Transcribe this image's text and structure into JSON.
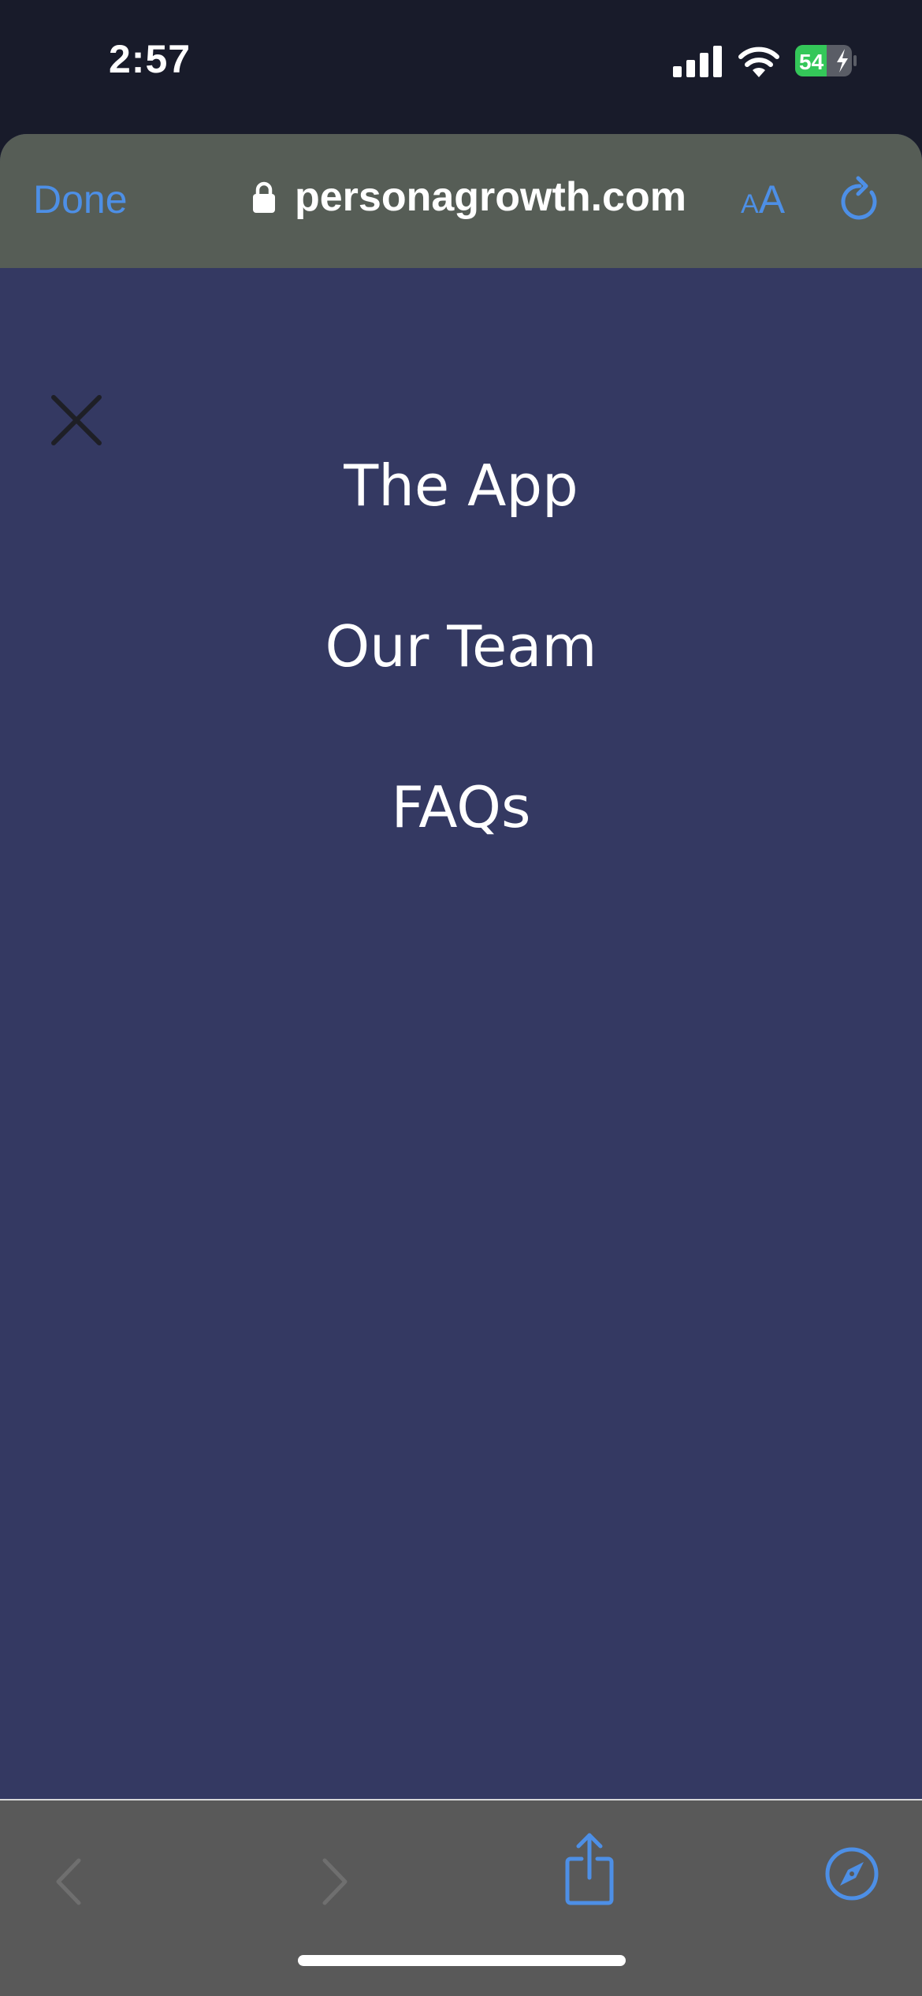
{
  "status_bar": {
    "time": "2:57",
    "battery": "54",
    "battery_level_percent": 54
  },
  "browser": {
    "done_label": "Done",
    "url": "personagrowth.com",
    "text_size_small": "A",
    "text_size_large": "A"
  },
  "menu": {
    "items": [
      {
        "label": "The App"
      },
      {
        "label": "Our Team"
      },
      {
        "label": "FAQs"
      }
    ]
  },
  "colors": {
    "accent_blue": "#4d8fe6",
    "page_background": "#343962",
    "toolbar_background": "#565d56",
    "bottom_bar_background": "#595959",
    "battery_green": "#34c759"
  },
  "icons": [
    "signal-icon",
    "wifi-icon",
    "battery-icon",
    "lock-icon",
    "reload-icon",
    "close-icon",
    "back-arrow-icon",
    "forward-arrow-icon",
    "share-icon",
    "compass-icon"
  ]
}
